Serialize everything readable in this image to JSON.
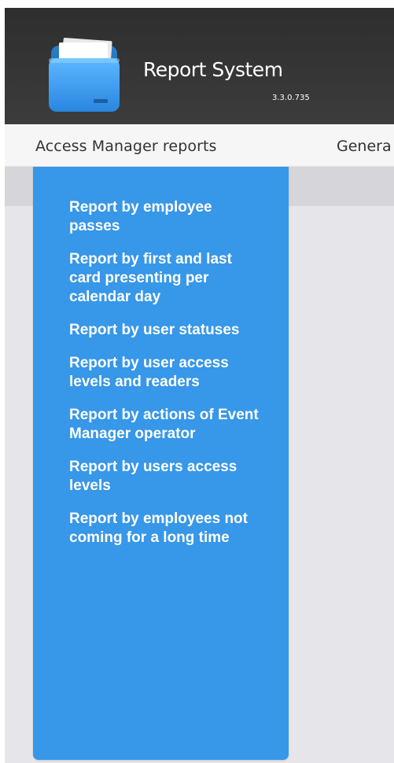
{
  "header": {
    "title": "Report System",
    "version": "3.3.0.735",
    "logo_icon": "folder-icon"
  },
  "menu": {
    "items": [
      {
        "label": "Access Manager reports"
      },
      {
        "label": "Genera"
      }
    ]
  },
  "dropdown": {
    "items": [
      {
        "label": "Report by employee passes"
      },
      {
        "label": "Report by first and last card presenting per calendar day"
      },
      {
        "label": "Report by user statuses"
      },
      {
        "label": "Report by user access levels and readers"
      },
      {
        "label": "Report by actions of Event Manager operator"
      },
      {
        "label": "Report by users access levels"
      },
      {
        "label": "Report by employees not coming for a long time"
      }
    ]
  },
  "colors": {
    "header_bg": "#333333",
    "menubar_bg": "#f6f6f6",
    "dropdown_bg": "#3797e8",
    "content_bg": "#e6e6ea"
  }
}
